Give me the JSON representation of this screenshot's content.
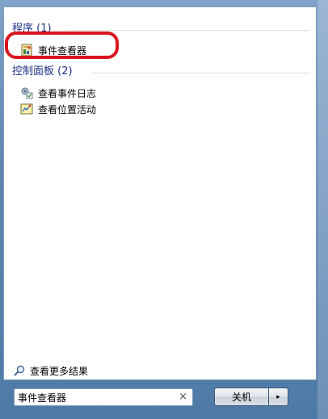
{
  "programs": {
    "header": "程序 (1)",
    "items": [
      {
        "label": "事件查看器",
        "icon": "event-viewer-icon"
      }
    ]
  },
  "control_panel": {
    "header": "控制面板 (2)",
    "items": [
      {
        "label": "查看事件日志",
        "icon": "event-log-icon"
      },
      {
        "label": "查看位置活动",
        "icon": "location-activity-icon"
      }
    ]
  },
  "footer": {
    "see_more": "查看更多结果"
  },
  "search": {
    "value": "事件查看器",
    "clear_glyph": "×"
  },
  "shutdown": {
    "label": "关机",
    "arrow_glyph": "▸"
  },
  "colors": {
    "group_header": "#1e3287",
    "highlight": "#d9161e"
  }
}
